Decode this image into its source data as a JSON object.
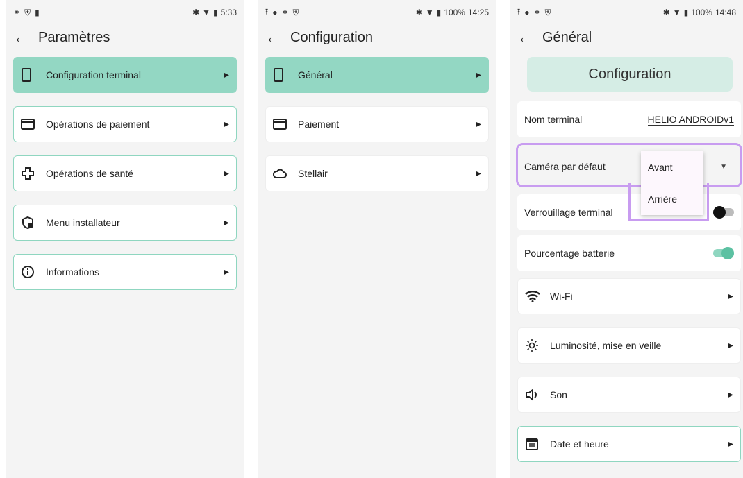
{
  "screen1": {
    "status_time": "5:33",
    "title": "Paramètres",
    "items": [
      {
        "label": "Configuration terminal"
      },
      {
        "label": "Opérations de paiement"
      },
      {
        "label": "Opérations de santé"
      },
      {
        "label": "Menu installateur"
      },
      {
        "label": "Informations"
      }
    ]
  },
  "screen2": {
    "status_battery": "100%",
    "status_time": "14:25",
    "title": "Configuration",
    "items": [
      {
        "label": "Général"
      },
      {
        "label": "Paiement"
      },
      {
        "label": "Stellair"
      }
    ]
  },
  "screen3": {
    "status_battery": "100%",
    "status_time": "14:48",
    "title": "Général",
    "section_header": "Configuration",
    "terminal_name_label": "Nom terminal",
    "terminal_name_value": "HELIO ANDROIDv1",
    "camera_label": "Caméra par défaut",
    "camera_options": [
      "Avant",
      "Arrière"
    ],
    "lock_label": "Verrouillage terminal",
    "lock_enabled": false,
    "battery_label": "Pourcentage batterie",
    "battery_enabled": true,
    "items": [
      {
        "label": "Wi-Fi"
      },
      {
        "label": "Luminosité, mise en veille"
      },
      {
        "label": "Son"
      },
      {
        "label": "Date et heure"
      }
    ]
  },
  "colors": {
    "accent": "#93d7c3",
    "border": "#8fd6c0",
    "highlight": "#c89cf0"
  }
}
